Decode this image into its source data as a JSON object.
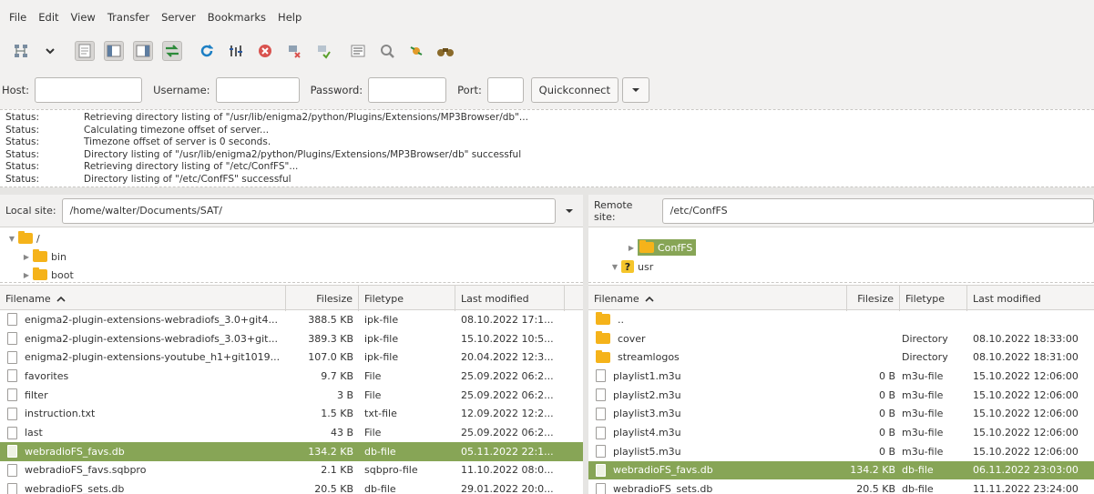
{
  "menu": [
    "File",
    "Edit",
    "View",
    "Transfer",
    "Server",
    "Bookmarks",
    "Help"
  ],
  "quickconnect": {
    "host_label": "Host:",
    "username_label": "Username:",
    "password_label": "Password:",
    "port_label": "Port:",
    "button": "Quickconnect"
  },
  "status_log": [
    {
      "label": "Status:",
      "msg": "Retrieving directory listing of \"/usr/lib/enigma2/python/Plugins/Extensions/MP3Browser/db\"..."
    },
    {
      "label": "Status:",
      "msg": "Calculating timezone offset of server..."
    },
    {
      "label": "Status:",
      "msg": "Timezone offset of server is 0 seconds."
    },
    {
      "label": "Status:",
      "msg": "Directory listing of \"/usr/lib/enigma2/python/Plugins/Extensions/MP3Browser/db\" successful"
    },
    {
      "label": "Status:",
      "msg": "Retrieving directory listing of \"/etc/ConfFS\"..."
    },
    {
      "label": "Status:",
      "msg": "Directory listing of \"/etc/ConfFS\" successful"
    }
  ],
  "local": {
    "site_label": "Local site:",
    "path": "/home/walter/Documents/SAT/",
    "tree": [
      "/",
      "bin",
      "boot"
    ],
    "headers": {
      "name": "Filename",
      "size": "Filesize",
      "type": "Filetype",
      "modified": "Last modified"
    },
    "files": [
      {
        "name": "enigma2-plugin-extensions-webradiofs_3.0+git4...",
        "size": "388.5 KB",
        "type": "ipk-file",
        "modified": "08.10.2022 17:1..."
      },
      {
        "name": "enigma2-plugin-extensions-webradiofs_3.03+git...",
        "size": "389.3 KB",
        "type": "ipk-file",
        "modified": "15.10.2022 10:5..."
      },
      {
        "name": "enigma2-plugin-extensions-youtube_h1+git1019...",
        "size": "107.0 KB",
        "type": "ipk-file",
        "modified": "20.04.2022 12:3..."
      },
      {
        "name": "favorites",
        "size": "9.7 KB",
        "type": "File",
        "modified": "25.09.2022 06:2..."
      },
      {
        "name": "filter",
        "size": "3 B",
        "type": "File",
        "modified": "25.09.2022 06:2..."
      },
      {
        "name": "instruction.txt",
        "size": "1.5 KB",
        "type": "txt-file",
        "modified": "12.09.2022 12:2..."
      },
      {
        "name": "last",
        "size": "43 B",
        "type": "File",
        "modified": "25.09.2022 06:2..."
      },
      {
        "name": "webradioFS_favs.db",
        "size": "134.2 KB",
        "type": "db-file",
        "modified": "05.11.2022 22:1...",
        "selected": true
      },
      {
        "name": "webradioFS_favs.sqbpro",
        "size": "2.1 KB",
        "type": "sqbpro-file",
        "modified": "11.10.2022 08:0..."
      },
      {
        "name": "webradioFS_sets.db",
        "size": "20.5 KB",
        "type": "db-file",
        "modified": "29.01.2022 20:0..."
      }
    ]
  },
  "remote": {
    "site_label": "Remote site:",
    "path": "/etc/ConfFS",
    "tree": [
      "ConfFS",
      "usr"
    ],
    "headers": {
      "name": "Filename",
      "size": "Filesize",
      "type": "Filetype",
      "modified": "Last modified"
    },
    "files": [
      {
        "name": "..",
        "size": "",
        "type": "",
        "modified": "",
        "kind": "folder"
      },
      {
        "name": "cover",
        "size": "",
        "type": "Directory",
        "modified": "08.10.2022 18:33:00",
        "kind": "folder"
      },
      {
        "name": "streamlogos",
        "size": "",
        "type": "Directory",
        "modified": "08.10.2022 18:31:00",
        "kind": "folder"
      },
      {
        "name": "playlist1.m3u",
        "size": "0 B",
        "type": "m3u-file",
        "modified": "15.10.2022 12:06:00"
      },
      {
        "name": "playlist2.m3u",
        "size": "0 B",
        "type": "m3u-file",
        "modified": "15.10.2022 12:06:00"
      },
      {
        "name": "playlist3.m3u",
        "size": "0 B",
        "type": "m3u-file",
        "modified": "15.10.2022 12:06:00"
      },
      {
        "name": "playlist4.m3u",
        "size": "0 B",
        "type": "m3u-file",
        "modified": "15.10.2022 12:06:00"
      },
      {
        "name": "playlist5.m3u",
        "size": "0 B",
        "type": "m3u-file",
        "modified": "15.10.2022 12:06:00"
      },
      {
        "name": "webradioFS_favs.db",
        "size": "134.2 KB",
        "type": "db-file",
        "modified": "06.11.2022 23:03:00",
        "selected": true
      },
      {
        "name": "webradioFS_sets.db",
        "size": "20.5 KB",
        "type": "db-file",
        "modified": "11.11.2022 23:24:00"
      }
    ]
  },
  "colors": {
    "selection": "#87a556",
    "folder": "#f5b31a"
  }
}
